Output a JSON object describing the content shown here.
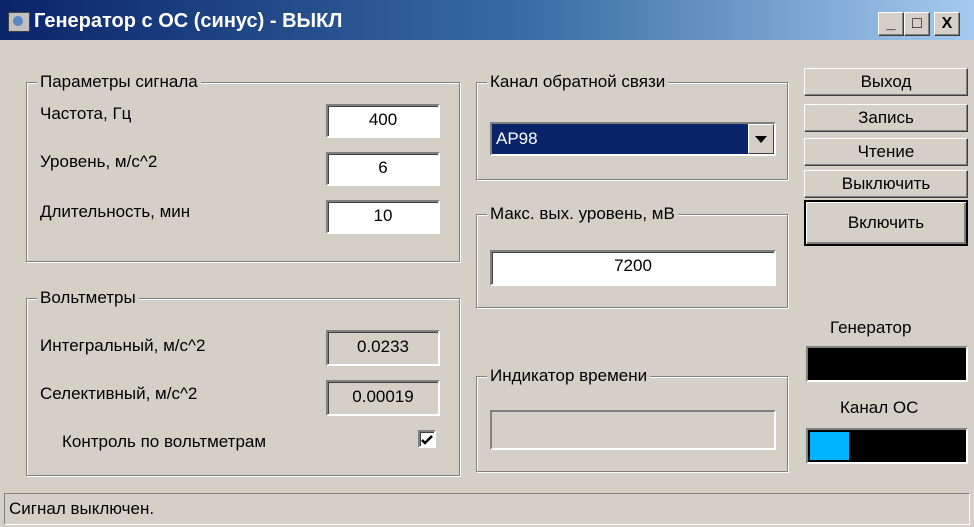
{
  "window": {
    "title": "Генератор с ОС (синус) - ВЫКЛ",
    "controls": [
      "_",
      "□",
      "X"
    ]
  },
  "signal_params": {
    "legend": "Параметры сигнала",
    "frequency_label": "Частота, Гц",
    "frequency_value": "400",
    "level_label": "Уровень, м/с^2",
    "level_value": "6",
    "duration_label": "Длительность, мин",
    "duration_value": "10"
  },
  "voltmeters": {
    "legend": "Вольтметры",
    "integral_label": "Интегральный, м/с^2",
    "integral_value": "0.0233",
    "selective_label": "Селективный, м/с^2",
    "selective_value": "0.00019",
    "control_label": "Контроль по вольтметрам",
    "control_checked": true
  },
  "feedback_channel": {
    "legend": "Канал обратной связи",
    "selected": "AP98"
  },
  "max_output": {
    "legend": "Макс. вых. уровень, мВ",
    "value": "7200"
  },
  "time_indicator": {
    "legend": "Индикатор времени",
    "progress": 0
  },
  "buttons": {
    "exit": "Выход",
    "record": "Запись",
    "read": "Чтение",
    "turn_off": "Выключить",
    "turn_on": "Включить"
  },
  "indicators": {
    "generator_label": "Генератор",
    "generator_level": 0,
    "channel_label": "Канал ОС",
    "channel_level": 0.25,
    "level_color": "#00b4ff"
  },
  "status_bar": {
    "text": "Сигнал выключен."
  }
}
